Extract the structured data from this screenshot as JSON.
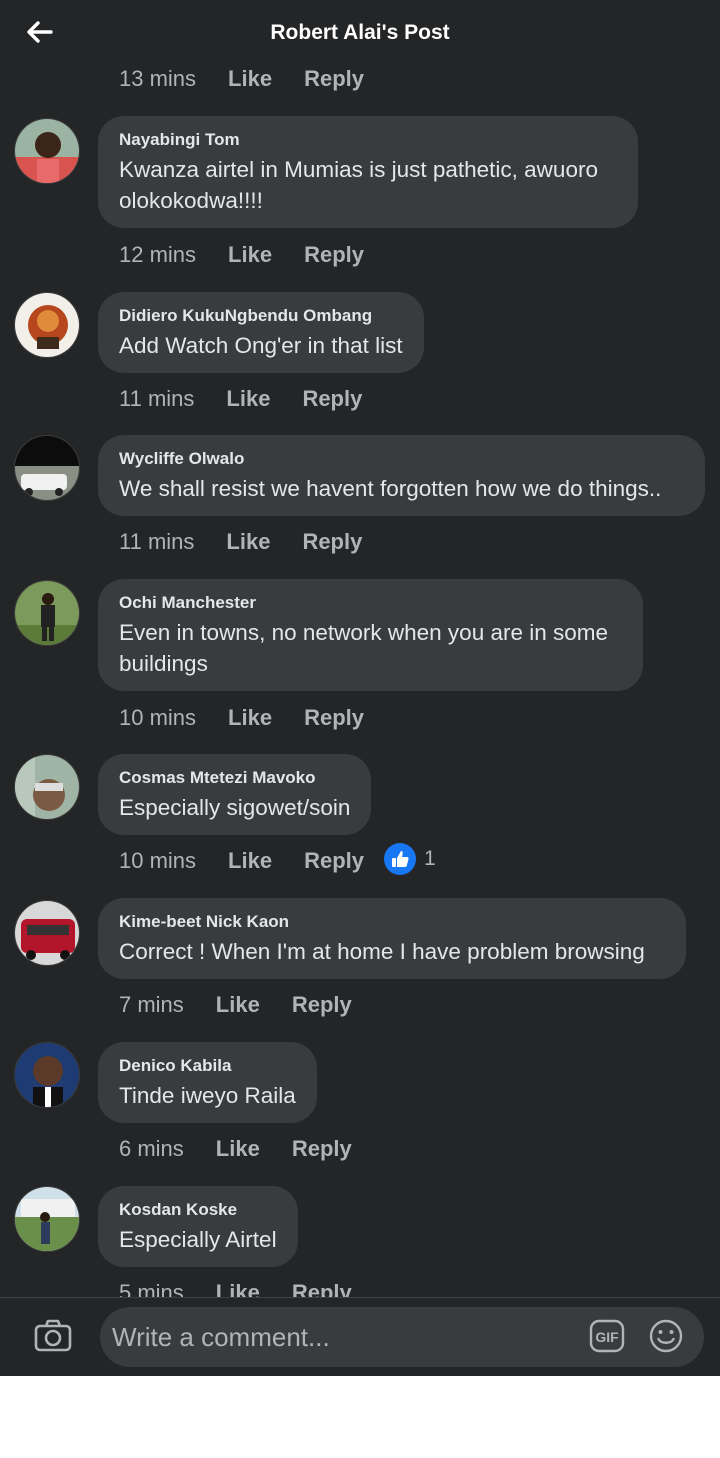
{
  "header": {
    "title": "Robert Alai's Post"
  },
  "top_partial": {
    "time": "13 mins",
    "like": "Like",
    "reply": "Reply"
  },
  "comments": [
    {
      "author": "Nayabingi Tom",
      "text": "Kwanza airtel in Mumias is just pathetic, awuoro olokokodwa!!!!",
      "time": "12 mins",
      "like": "Like",
      "reply": "Reply"
    },
    {
      "author": "Didiero KukuNgbendu Ombang",
      "text": "Add Watch Ong'er in that list",
      "time": "11 mins",
      "like": "Like",
      "reply": "Reply"
    },
    {
      "author": "Wycliffe Olwalo",
      "text": "We shall resist we havent forgotten how we do things..",
      "time": "11 mins",
      "like": "Like",
      "reply": "Reply"
    },
    {
      "author": "Ochi Manchester",
      "text": "Even in towns, no network when you are in some buildings",
      "time": "10 mins",
      "like": "Like",
      "reply": "Reply"
    },
    {
      "author": "Cosmas Mtetezi Mavoko",
      "text": "Especially sigowet/soin",
      "time": "10 mins",
      "like": "Like",
      "reply": "Reply",
      "reaction_count": "1",
      "reaction_icon": "thumbs-up-icon"
    },
    {
      "author": "Kime-beet Nick Kaon",
      "text": "Correct ! When I'm at home I have problem browsing",
      "time": "7 mins",
      "like": "Like",
      "reply": "Reply"
    },
    {
      "author": "Denico Kabila",
      "text": "Tinde iweyo Raila",
      "time": "6 mins",
      "like": "Like",
      "reply": "Reply"
    },
    {
      "author": "Kosdan Koske",
      "text": "Especially Airtel",
      "time": "5 mins",
      "like": "Like",
      "reply": "Reply"
    }
  ],
  "composer": {
    "placeholder": "Write a comment...",
    "gif_label": "GIF"
  },
  "colors": {
    "background": "#242526",
    "bubble": "#3a3b3c",
    "text": "#e4e6eb",
    "muted": "#b0b3b8",
    "like_blue": "#1877f2"
  },
  "icons": {
    "back": "arrow-left-icon",
    "camera": "camera-icon",
    "gif": "gif-icon",
    "emoji": "smiley-icon"
  }
}
